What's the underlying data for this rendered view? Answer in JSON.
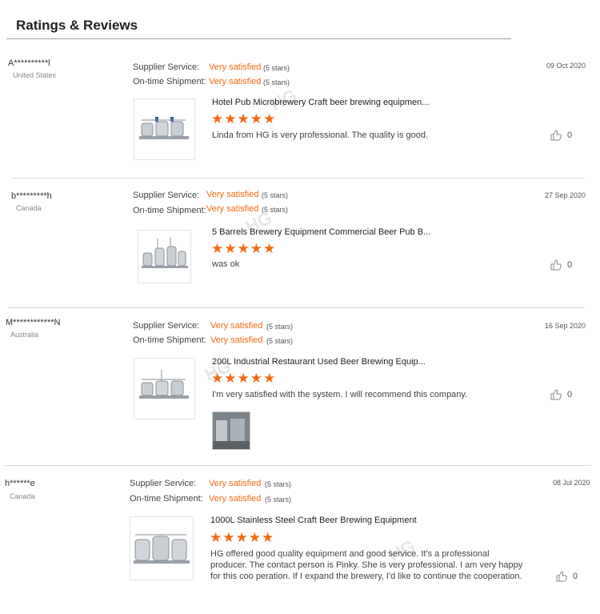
{
  "page": {
    "title": "Ratings & Reviews"
  },
  "labels": {
    "supplier_service": "Supplier Service:",
    "on_time_shipment": "On-time Shipment:"
  },
  "reviews": [
    {
      "user": "A**********l",
      "country": "United States",
      "supplier_rating": "Very satisfied",
      "supplier_stars": "(5 stars)",
      "shipment_rating": "Very satisfied",
      "shipment_stars": "(5 stars)",
      "date": "09 Oct 2020",
      "product": "Hotel Pub Microbrewery Craft beer brewing equipmen...",
      "stars": "★★★★★",
      "text": "Linda from HG is very professional. The quality is good.",
      "likes": "0"
    },
    {
      "user": "b*********h",
      "country": "Canada",
      "supplier_rating": "Very satisfied",
      "supplier_stars": "(5 stars)",
      "shipment_rating": "Very satisfied",
      "shipment_stars": "(5 stars)",
      "date": "27 Sep 2020",
      "product": "5 Barrels Brewery Equipment Commercial Beer Pub B...",
      "stars": "★★★★★",
      "text": "was ok",
      "likes": "0"
    },
    {
      "user": "M************N",
      "country": "Australia",
      "supplier_rating": "Very satisfied",
      "supplier_stars": "(5 stars)",
      "shipment_rating": "Very satisfied",
      "shipment_stars": "(5 stars)",
      "date": "16 Sep 2020",
      "product": "200L Industrial Restaurant Used Beer Brewing Equip...",
      "stars": "★★★★★",
      "text": "I'm very satisfied with the system. I will recommend this company.",
      "likes": "0"
    },
    {
      "user": "h******e",
      "country": "Canada",
      "supplier_rating": "Very satisfied",
      "supplier_stars": "(5 stars)",
      "shipment_rating": "Very satisfied",
      "shipment_stars": "(5 stars)",
      "date": "08 Jul 2020",
      "product": "1000L Stainless Steel Craft Beer Brewing Equipment",
      "stars": "★★★★★",
      "text": "HG offered good quality equipment and good service. It's a professional producer. The contact person is Pinky. She is very professional. I am very happy for this coo peration. If I expand the brewery, I'd like to continue the cooperation.",
      "likes": "0"
    }
  ],
  "watermark": "HG",
  "colors": {
    "accent": "#f06a14",
    "separator": "#d9d9d9"
  }
}
